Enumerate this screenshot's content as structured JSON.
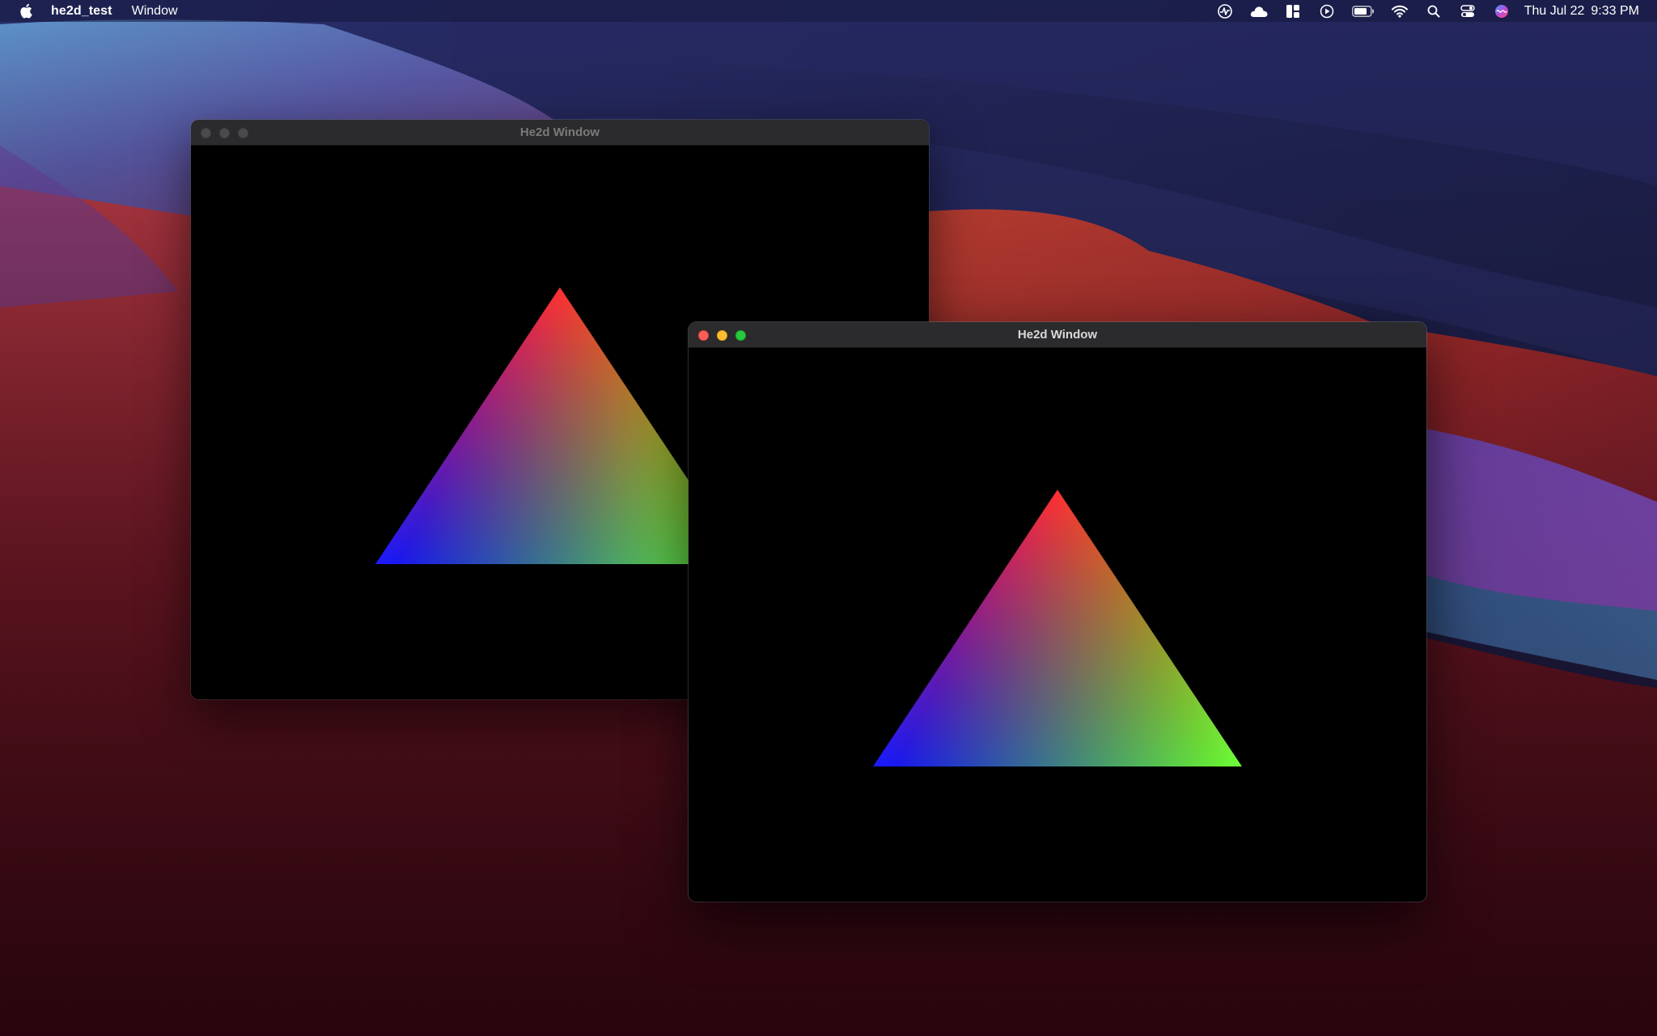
{
  "menubar": {
    "app_name": "he2d_test",
    "menus": [
      "Window"
    ],
    "status_icons": [
      "activity-monitor-icon",
      "icloud-icon",
      "window-manager-icon",
      "play-icon",
      "battery-icon",
      "wifi-icon",
      "spotlight-search-icon",
      "control-center-icon",
      "siri-icon"
    ],
    "clock": {
      "date": "Thu Jul 22",
      "time": "9:33 PM"
    }
  },
  "windows": [
    {
      "title": "He2d Window",
      "state": "inactive",
      "canvas_background": "#000000",
      "triangle_vertex_colors": {
        "top": "#ff2020",
        "bottom_left": "#1a1aff",
        "bottom_right": "#6dff3a"
      }
    },
    {
      "title": "He2d Window",
      "state": "active",
      "canvas_background": "#000000",
      "triangle_vertex_colors": {
        "top": "#ff2020",
        "bottom_left": "#1a1aff",
        "bottom_right": "#6dff3a"
      }
    }
  ],
  "theme": {
    "traffic_close": "#ff5f57",
    "traffic_minimize": "#febc2e",
    "traffic_zoom": "#28c840"
  }
}
